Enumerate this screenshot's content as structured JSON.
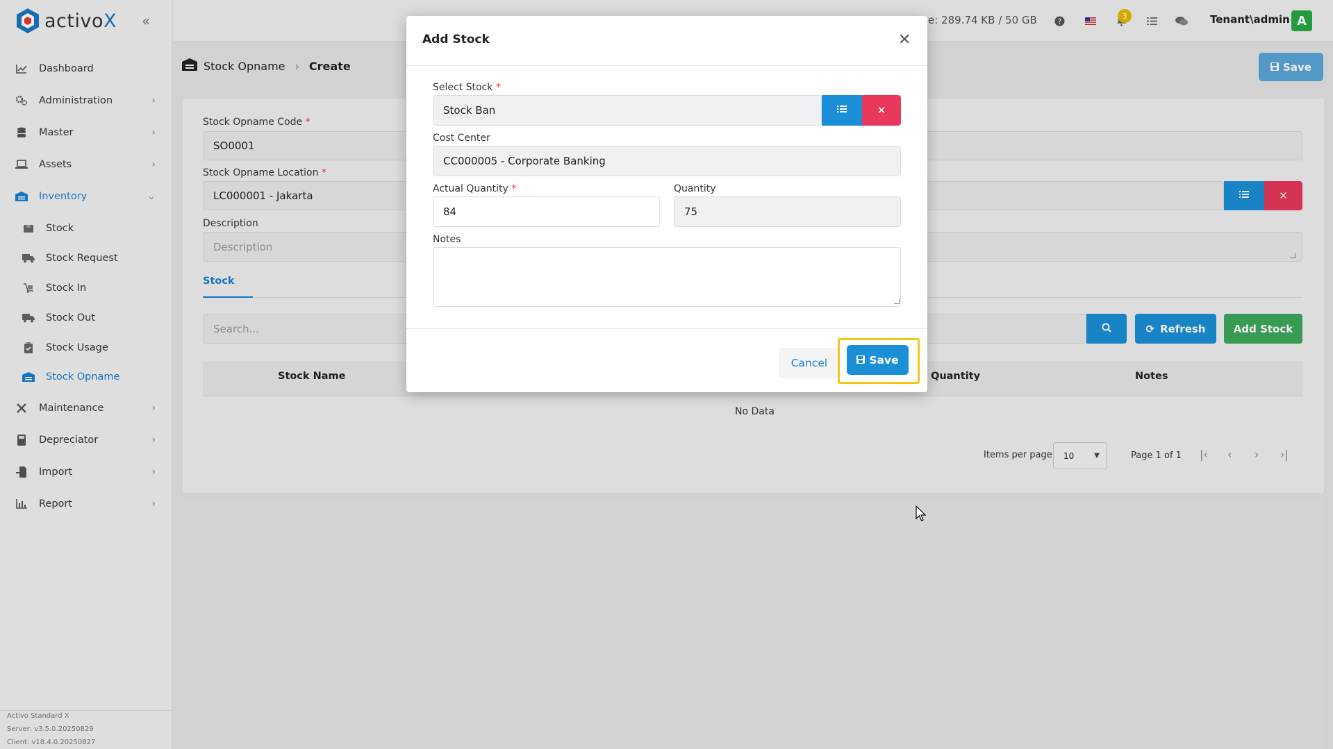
{
  "app": {
    "logo_text": "activo",
    "logo_x": "X"
  },
  "sidebar": {
    "items": [
      {
        "label": "Dashboard"
      },
      {
        "label": "Administration"
      },
      {
        "label": "Master"
      },
      {
        "label": "Assets"
      },
      {
        "label": "Inventory"
      },
      {
        "label": "Stock"
      },
      {
        "label": "Stock Request"
      },
      {
        "label": "Stock In"
      },
      {
        "label": "Stock Out"
      },
      {
        "label": "Stock Usage"
      },
      {
        "label": "Stock Opname"
      },
      {
        "label": "Maintenance"
      },
      {
        "label": "Depreciator"
      },
      {
        "label": "Import"
      },
      {
        "label": "Report"
      }
    ],
    "version": {
      "product": "Activo Standard X",
      "server": "Server: v3.5.0.20250829",
      "client": "Client: v18.4.0.20250827"
    }
  },
  "topbar": {
    "storage_text": "e: 289.74 KB / 50 GB",
    "notification_count": "3",
    "user": "Tenant\\admin",
    "avatar_letter": "A"
  },
  "breadcrumb": {
    "section": "Stock Opname",
    "current": "Create"
  },
  "page": {
    "save_label": "Save",
    "code_label": "Stock Opname Code",
    "code_value": "SO0001",
    "location_label": "Stock Opname Location",
    "location_value": "LC000001 - Jakarta",
    "description_label": "Description",
    "description_placeholder": "Description",
    "tab_stock": "Stock",
    "search_placeholder": "Search...",
    "refresh_label": "Refresh",
    "add_stock_label": "Add Stock",
    "table_headers": [
      "Stock Name",
      "Quantity",
      "Notes"
    ],
    "table_header_partial": "Quantity",
    "no_data": "No Data",
    "items_per_page_label": "Items per page",
    "items_per_page_value": "10",
    "page_info": "Page 1 of 1"
  },
  "modal": {
    "title": "Add Stock",
    "select_stock_label": "Select Stock",
    "select_stock_value": "Stock Ban",
    "cost_center_label": "Cost Center",
    "cost_center_value": "CC000005 - Corporate Banking",
    "actual_quantity_label": "Actual Quantity",
    "actual_quantity_value": "84",
    "quantity_label": "Quantity",
    "quantity_value": "75",
    "notes_label": "Notes",
    "notes_value": "",
    "cancel_label": "Cancel",
    "save_label": "Save"
  }
}
